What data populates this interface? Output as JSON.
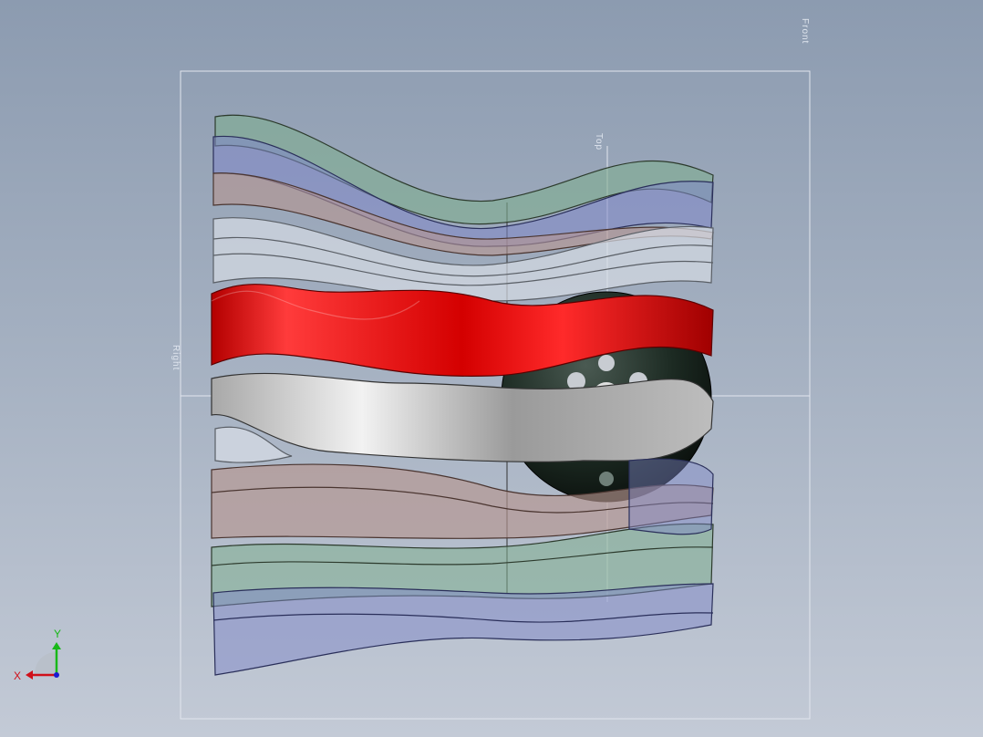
{
  "viewport": {
    "background_top": "#8c9bb0",
    "background_bottom": "#c3cad6"
  },
  "planes": {
    "front": "Front",
    "right": "Right",
    "top": "Top"
  },
  "triad": {
    "x_label": "X",
    "y_label": "Y",
    "x_color": "#d0101a",
    "y_color": "#18b818",
    "z_color": "#1a1ad0"
  },
  "model": {
    "selected_color": "#d00000",
    "highlight_color": "#9c9c9c",
    "translucent_colors": [
      "#7fae8f",
      "#7f87c8",
      "#b5958f",
      "#d6dbe4"
    ],
    "sphere_color": "#1c2a22"
  }
}
